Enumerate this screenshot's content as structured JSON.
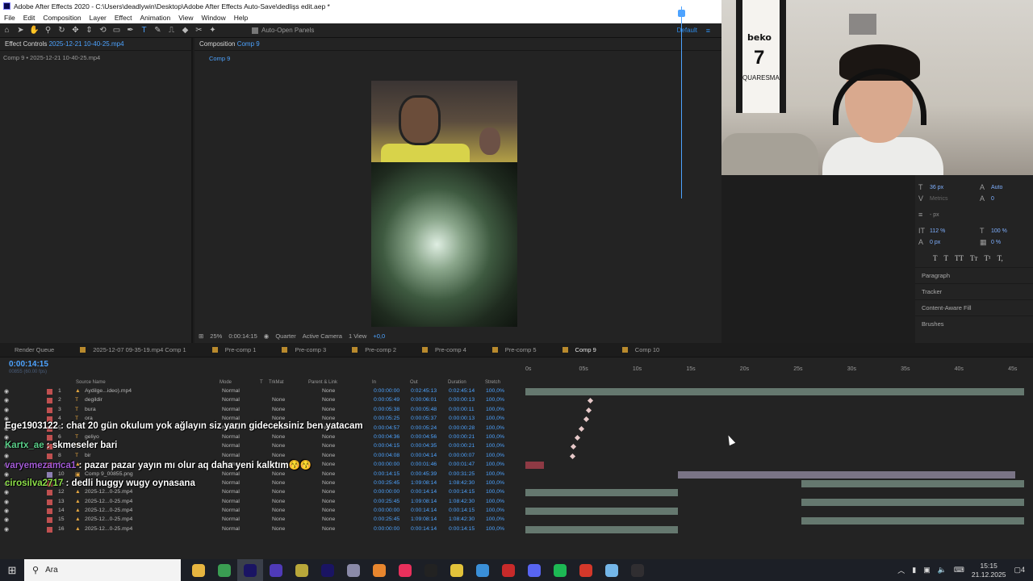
{
  "window": {
    "title": "Adobe After Effects 2020 - C:\\Users\\deadlywin\\Desktop\\Adobe After Effects Auto-Save\\dedlişs edit.aep *"
  },
  "menu": [
    "File",
    "Edit",
    "Composition",
    "Layer",
    "Effect",
    "Animation",
    "View",
    "Window",
    "Help"
  ],
  "toolbar": {
    "auto_open": "Auto-Open Panels",
    "workspace": "Default",
    "tool_icons": [
      "home-icon",
      "selection-icon",
      "hand-icon",
      "zoom-icon",
      "orbit-icon",
      "pan-icon",
      "dolly-icon",
      "rotate-icon",
      "rect-icon",
      "pen-icon",
      "type-icon",
      "brush-icon",
      "stamp-icon",
      "eraser-icon",
      "roto-icon",
      "puppet-icon"
    ]
  },
  "effect_controls": {
    "tab_label": "Effect Controls",
    "tab_file": "2025-12-21 10-40-25.mp4",
    "subtitle": "Comp 9 • 2025-12-21 10-40-25.mp4"
  },
  "composition": {
    "tab_label": "Composition",
    "tab_comp": "Comp 9",
    "sub_tab": "Comp 9"
  },
  "viewer_bar": {
    "zoom": "25%",
    "time": "0:00:14:15",
    "resolution": "Quarter",
    "camera": "Active Camera",
    "views": "1 View",
    "exposure": "+0,0"
  },
  "character": {
    "font_size": "36 px",
    "leading": "Auto",
    "kerning": "Metrics",
    "tracking": "0",
    "stroke": "- px",
    "v_scale": "112 %",
    "h_scale": "100 %",
    "baseline": "0 px",
    "tsume": "0 %",
    "styles": [
      "T",
      "T",
      "TT",
      "Tт",
      "T¹",
      "T,"
    ],
    "sections": [
      "Paragraph",
      "Tracker",
      "Content-Aware Fill",
      "Brushes"
    ]
  },
  "timeline_tabs": [
    {
      "label": "Render Queue",
      "color": ""
    },
    {
      "label": "2025-12-07 09-35-19.mp4 Comp 1",
      "color": "#b98a2d"
    },
    {
      "label": "Pre-comp 1",
      "color": "#b98a2d"
    },
    {
      "label": "Pre-comp 3",
      "color": "#b98a2d"
    },
    {
      "label": "Pre-comp 2",
      "color": "#b98a2d"
    },
    {
      "label": "Pre-comp 4",
      "color": "#b98a2d"
    },
    {
      "label": "Pre-comp 5",
      "color": "#b98a2d"
    },
    {
      "label": "Comp 9",
      "color": "#b98a2d"
    },
    {
      "label": "Comp 10",
      "color": "#b98a2d"
    }
  ],
  "timeline": {
    "time": "0:00:14:15",
    "time_sub": "00855 (60.00 fps)",
    "columns": {
      "source": "Source Name",
      "mode": "Mode",
      "t": "T",
      "trkmat": "TrkMat",
      "parent": "Parent & Link",
      "in": "In",
      "out": "Out",
      "duration": "Duration",
      "stretch": "Stretch"
    },
    "ruler": [
      "0s",
      "05s",
      "10s",
      "15s",
      "20s",
      "25s",
      "30s",
      "35s",
      "40s",
      "45s"
    ],
    "layers": [
      {
        "num": "1",
        "type": "▲",
        "name": "Aydilge...ideo).mp4",
        "mode": "Normal",
        "trk": "",
        "parent": "None",
        "in": "0:00:00:00",
        "out": "0:02:45:13",
        "dur": "0:02:45:14",
        "str": "100,0%",
        "color": "#c05050"
      },
      {
        "num": "2",
        "type": "T",
        "name": "degildir",
        "mode": "Normal",
        "trk": "None",
        "parent": "None",
        "in": "0:00:05:49",
        "out": "0:00:06:01",
        "dur": "0:00:00:13",
        "str": "100,0%",
        "color": "#c05050"
      },
      {
        "num": "3",
        "type": "T",
        "name": "bura",
        "mode": "Normal",
        "trk": "None",
        "parent": "None",
        "in": "0:00:05:38",
        "out": "0:00:05:48",
        "dur": "0:00:00:11",
        "str": "100,0%",
        "color": "#c05050"
      },
      {
        "num": "4",
        "type": "T",
        "name": "ora",
        "mode": "Normal",
        "trk": "None",
        "parent": "None",
        "in": "0:00:05:25",
        "out": "0:00:05:37",
        "dur": "0:00:00:13",
        "str": "100,0%",
        "color": "#c05050"
      },
      {
        "num": "5",
        "type": "T",
        "name": "",
        "mode": "Normal",
        "trk": "None",
        "parent": "None",
        "in": "0:00:04:57",
        "out": "0:00:05:24",
        "dur": "0:00:00:28",
        "str": "100,0%",
        "color": "#c05050"
      },
      {
        "num": "6",
        "type": "T",
        "name": "geliyo",
        "mode": "Normal",
        "trk": "None",
        "parent": "None",
        "in": "0:00:04:36",
        "out": "0:00:04:56",
        "dur": "0:00:00:21",
        "str": "100,0%",
        "color": "#c05050"
      },
      {
        "num": "7",
        "type": "T",
        "name": "",
        "mode": "Normal",
        "trk": "None",
        "parent": "None",
        "in": "0:00:04:15",
        "out": "0:00:04:35",
        "dur": "0:00:00:21",
        "str": "100,0%",
        "color": "#c05050"
      },
      {
        "num": "8",
        "type": "T",
        "name": "bir",
        "mode": "Normal",
        "trk": "None",
        "parent": "None",
        "in": "0:00:04:08",
        "out": "0:00:04:14",
        "dur": "0:00:00:07",
        "str": "100,0%",
        "color": "#c05050"
      },
      {
        "num": "9",
        "type": "▲",
        "name": "",
        "mode": "Normal",
        "trk": "None",
        "parent": "None",
        "in": "0:00:00:00",
        "out": "0:00:01:46",
        "dur": "0:00:01:47",
        "str": "100,0%",
        "color": "#c05050"
      },
      {
        "num": "10",
        "type": "▣",
        "name": "Comp 9_00855.png",
        "mode": "Normal",
        "trk": "None",
        "parent": "None",
        "in": "0:00:14:15",
        "out": "0:00:45:39",
        "dur": "0:00:31:25",
        "str": "100,0%",
        "color": "#8d7fb3"
      },
      {
        "num": "11",
        "type": "▲",
        "name": "",
        "mode": "Normal",
        "trk": "None",
        "parent": "None",
        "in": "0:00:25:45",
        "out": "1:09:08:14",
        "dur": "1:08:42:30",
        "str": "100,0%",
        "color": "#c05050"
      },
      {
        "num": "12",
        "type": "▲",
        "name": "2025-12...0-25.mp4",
        "mode": "Normal",
        "trk": "None",
        "parent": "None",
        "in": "0:00:00:00",
        "out": "0:00:14:14",
        "dur": "0:00:14:15",
        "str": "100,0%",
        "color": "#c05050"
      },
      {
        "num": "13",
        "type": "▲",
        "name": "2025-12...0-25.mp4",
        "mode": "Normal",
        "trk": "None",
        "parent": "None",
        "in": "0:00:25:45",
        "out": "1:09:08:14",
        "dur": "1:08:42:30",
        "str": "100,0%",
        "color": "#c05050"
      },
      {
        "num": "14",
        "type": "▲",
        "name": "2025-12...0-25.mp4",
        "mode": "Normal",
        "trk": "None",
        "parent": "None",
        "in": "0:00:00:00",
        "out": "0:00:14:14",
        "dur": "0:00:14:15",
        "str": "100,0%",
        "color": "#c05050"
      },
      {
        "num": "15",
        "type": "▲",
        "name": "2025-12...0-25.mp4",
        "mode": "Normal",
        "trk": "None",
        "parent": "None",
        "in": "0:00:25:45",
        "out": "1:09:08:14",
        "dur": "1:08:42:30",
        "str": "100,0%",
        "color": "#c05050"
      },
      {
        "num": "16",
        "type": "▲",
        "name": "2025-12...0-25.mp4",
        "mode": "Normal",
        "trk": "None",
        "parent": "None",
        "in": "0:00:00:00",
        "out": "0:00:14:14",
        "dur": "0:00:14:15",
        "str": "100,0%",
        "color": "#c05050"
      }
    ]
  },
  "chat": [
    {
      "user": "Ege1903122",
      "text": " : chat 20 gün okulum yok ağlayın siz yarın gideceksiniz ben yatacam",
      "color": "#ffffff"
    },
    {
      "user": "Kartx_ae",
      "text": " : skmeseler bari",
      "color": "#5bd08a"
    },
    {
      "user": "varyemezamca1",
      "text": " : pazar pazar yayın mı olur aq daha yeni kalktım😚😚",
      "color": "#a35bd6"
    },
    {
      "user": "cirosilva2717",
      "text": " : dedli huggy wugy oynasana",
      "color": "#8ee04a"
    }
  ],
  "webcam": {
    "jersey_sponsor": "beko",
    "jersey_number": "7",
    "jersey_name": "QUARESMA"
  },
  "taskbar": {
    "search_placeholder": "Ara",
    "apps": [
      {
        "name": "file-explorer-icon",
        "color": "#e7b540"
      },
      {
        "name": "chrome-icon",
        "color": "#3a9d52"
      },
      {
        "name": "after-effects-icon",
        "color": "#1a1463"
      },
      {
        "name": "vpn-icon",
        "color": "#4f3ab8"
      },
      {
        "name": "game-icon",
        "color": "#b8a73a"
      },
      {
        "name": "media-encoder-icon",
        "color": "#1a1463"
      },
      {
        "name": "settings-icon",
        "color": "#8a8aa8"
      },
      {
        "name": "vlc-icon",
        "color": "#e8862e"
      },
      {
        "name": "tiktok-icon",
        "color": "#e8305c"
      },
      {
        "name": "stream-icon",
        "color": "#222222"
      },
      {
        "name": "maps-icon",
        "color": "#e2c23a"
      },
      {
        "name": "photos-icon",
        "color": "#3a8fd8"
      },
      {
        "name": "media-icon",
        "color": "#c82a2a"
      },
      {
        "name": "discord-icon",
        "color": "#5865f2"
      },
      {
        "name": "spotify-icon",
        "color": "#1db954"
      },
      {
        "name": "opera-icon",
        "color": "#d4382a"
      },
      {
        "name": "notepad-icon",
        "color": "#74b6e8"
      },
      {
        "name": "obs-icon",
        "color": "#302e31"
      }
    ],
    "time": "15:15",
    "date": "21.12.2025",
    "notifications": "4"
  }
}
